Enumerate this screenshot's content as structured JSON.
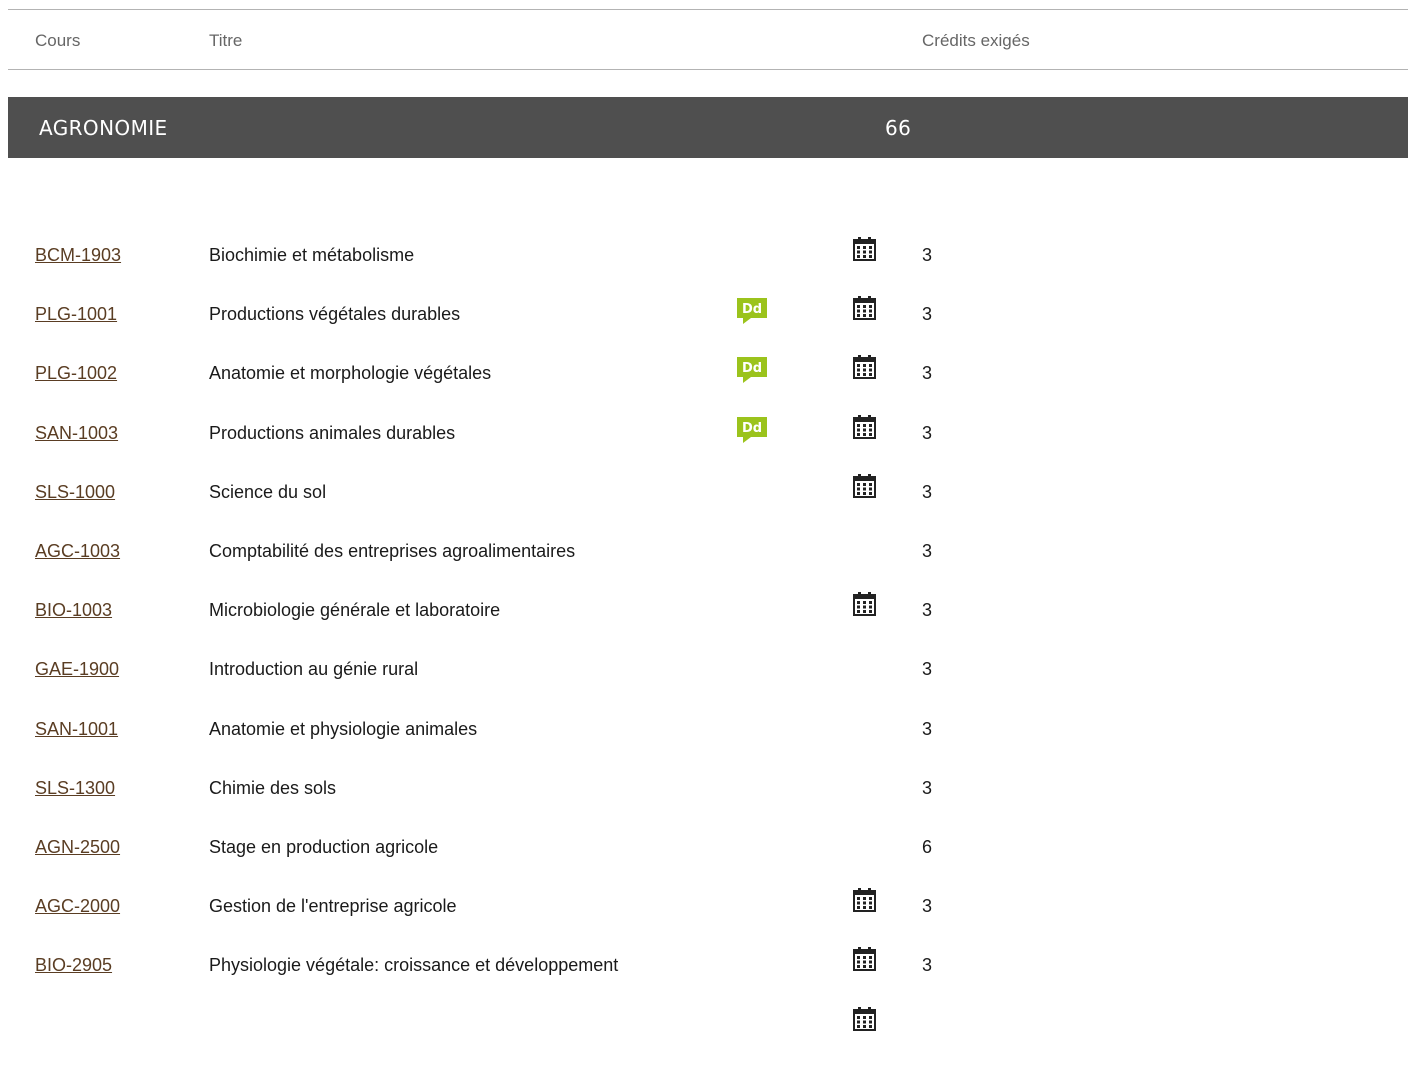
{
  "header": {
    "col_course": "Cours",
    "col_title": "Titre",
    "col_credits": "Crédits exigés"
  },
  "section": {
    "name": "AGRONOMIE",
    "credits": "66"
  },
  "icons": {
    "dd_icon": "dd-badge-icon",
    "calendar_icon": "calendar-icon",
    "dd_color": "#9bc31c",
    "link_color": "#5a3d23",
    "section_bg": "#4f4f4f"
  },
  "rows": [
    {
      "code": "BCM-1903",
      "title": "Biochimie et métabolisme",
      "credits": "3",
      "dd": false,
      "calendar": true
    },
    {
      "code": "PLG-1001",
      "title": "Productions végétales durables",
      "credits": "3",
      "dd": true,
      "calendar": true
    },
    {
      "code": "PLG-1002",
      "title": "Anatomie et morphologie végétales",
      "credits": "3",
      "dd": true,
      "calendar": true
    },
    {
      "code": "SAN-1003",
      "title": "Productions animales durables",
      "credits": "3",
      "dd": true,
      "calendar": true
    },
    {
      "code": "SLS-1000",
      "title": "Science du sol",
      "credits": "3",
      "dd": false,
      "calendar": true
    },
    {
      "code": "AGC-1003",
      "title": "Comptabilité des entreprises agroalimentaires",
      "credits": "3",
      "dd": false,
      "calendar": false
    },
    {
      "code": "BIO-1003",
      "title": "Microbiologie générale et laboratoire",
      "credits": "3",
      "dd": false,
      "calendar": true
    },
    {
      "code": "GAE-1900",
      "title": "Introduction au génie rural",
      "credits": "3",
      "dd": false,
      "calendar": false
    },
    {
      "code": "SAN-1001",
      "title": "Anatomie et physiologie animales",
      "credits": "3",
      "dd": false,
      "calendar": false
    },
    {
      "code": "SLS-1300",
      "title": "Chimie des sols",
      "credits": "3",
      "dd": false,
      "calendar": false
    },
    {
      "code": "AGN-2500",
      "title": "Stage en production agricole",
      "credits": "6",
      "dd": false,
      "calendar": false
    },
    {
      "code": "AGC-2000",
      "title": "Gestion de l'entreprise agricole",
      "credits": "3",
      "dd": false,
      "calendar": true
    },
    {
      "code": "BIO-2905",
      "title": "Physiologie végétale: croissance et développement",
      "credits": "3",
      "dd": false,
      "calendar": true
    },
    {
      "code": "",
      "title": "",
      "credits": "",
      "dd": false,
      "calendar": true
    }
  ]
}
